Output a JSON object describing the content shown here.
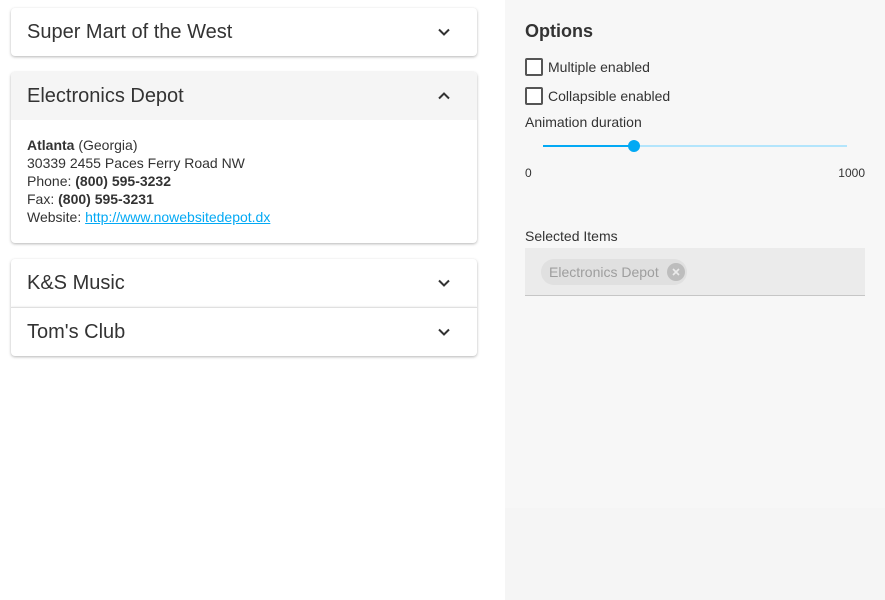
{
  "accordion": {
    "items": [
      {
        "title": "Super Mart of the West",
        "expanded": false
      },
      {
        "title": "Electronics Depot",
        "expanded": true,
        "details": {
          "city": "Atlanta",
          "state": "(Georgia)",
          "address": "30339 2455 Paces Ferry Road NW",
          "phone_label": "Phone:",
          "phone": "(800) 595-3232",
          "fax_label": "Fax:",
          "fax": "(800) 595-3231",
          "website_label": "Website:",
          "website": "http://www.nowebsitedepot.dx"
        }
      },
      {
        "title": "K&S Music",
        "expanded": false
      },
      {
        "title": "Tom's Club",
        "expanded": false
      }
    ]
  },
  "options": {
    "title": "Options",
    "multiple_label": "Multiple enabled",
    "multiple_checked": false,
    "collapsible_label": "Collapsible enabled",
    "collapsible_checked": false,
    "animation_label": "Animation duration",
    "animation_value": 300,
    "animation_min": "0",
    "animation_max": "1000",
    "selected_label": "Selected Items",
    "selected_items": [
      "Electronics Depot"
    ]
  },
  "colors": {
    "accent": "#03a9f4",
    "panel_bg": "#f7f7f7"
  },
  "icons": {
    "collapsed": "chevron-down-icon",
    "expanded": "chevron-up-icon",
    "remove": "close-circle-icon"
  }
}
